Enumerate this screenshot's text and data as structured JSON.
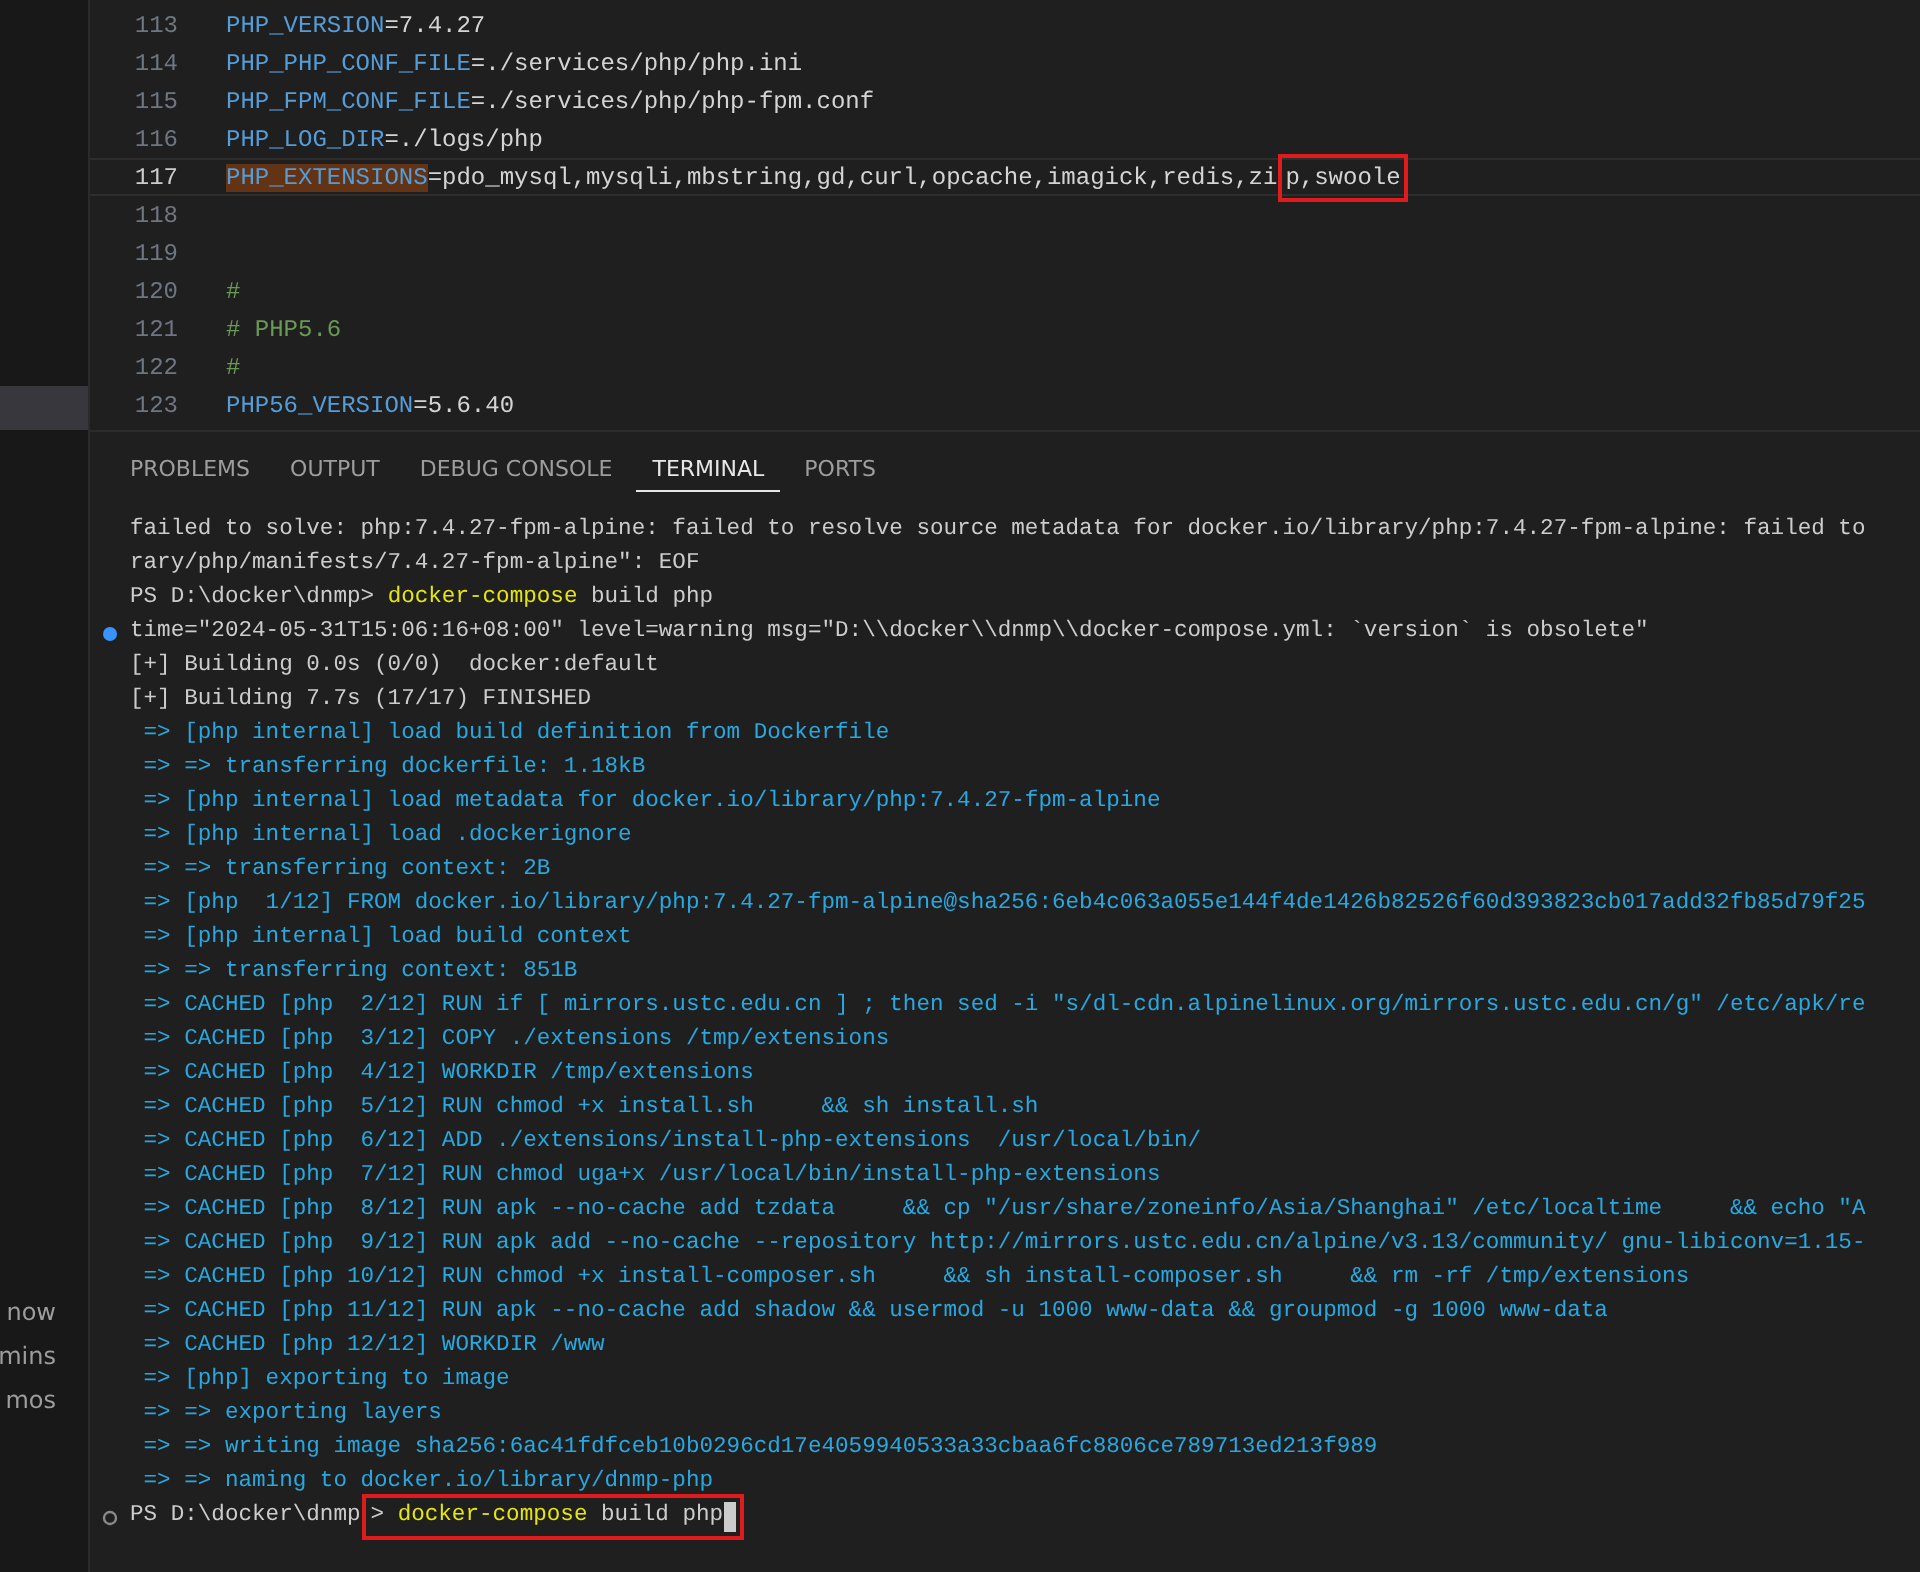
{
  "sidebar": {
    "times": [
      "now",
      "mins",
      "mos"
    ]
  },
  "editor": {
    "lines": [
      {
        "number": "113",
        "current": false,
        "segments": [
          {
            "text": "PHP_VERSION",
            "kind": "key"
          },
          {
            "text": "=7.4.27",
            "kind": "value"
          }
        ]
      },
      {
        "number": "114",
        "current": false,
        "segments": [
          {
            "text": "PHP_PHP_CONF_FILE",
            "kind": "key"
          },
          {
            "text": "=./services/php/php.ini",
            "kind": "value"
          }
        ]
      },
      {
        "number": "115",
        "current": false,
        "segments": [
          {
            "text": "PHP_FPM_CONF_FILE",
            "kind": "key"
          },
          {
            "text": "=./services/php/php-fpm.conf",
            "kind": "value"
          }
        ]
      },
      {
        "number": "116",
        "current": false,
        "segments": [
          {
            "text": "PHP_LOG_DIR",
            "kind": "key"
          },
          {
            "text": "=./logs/php",
            "kind": "value"
          }
        ]
      },
      {
        "number": "117",
        "current": true,
        "segments": [
          {
            "text": "PHP_EXTENSIONS",
            "kind": "key",
            "highlighted": true
          },
          {
            "text": "=pdo_mysql,mysqli,mbstring,gd,curl,opcache,imagick,redis,zi",
            "kind": "value"
          },
          {
            "text": "p,swoole",
            "kind": "value",
            "boxed": true
          }
        ]
      },
      {
        "number": "118",
        "current": false
      },
      {
        "number": "119",
        "current": false
      },
      {
        "number": "120",
        "current": false,
        "segments": [
          {
            "text": "#",
            "kind": "comment"
          }
        ]
      },
      {
        "number": "121",
        "current": false,
        "segments": [
          {
            "text": "# PHP5.6",
            "kind": "comment"
          }
        ]
      },
      {
        "number": "122",
        "current": false,
        "segments": [
          {
            "text": "#",
            "kind": "comment"
          }
        ]
      },
      {
        "number": "123",
        "current": false,
        "segments": [
          {
            "text": "PHP56_VERSION",
            "kind": "key"
          },
          {
            "text": "=5.6.40",
            "kind": "value"
          }
        ]
      }
    ]
  },
  "panel": {
    "tabs": [
      {
        "label": "PROBLEMS",
        "selected": false
      },
      {
        "label": "OUTPUT",
        "selected": false
      },
      {
        "label": "DEBUG CONSOLE",
        "selected": false
      },
      {
        "label": "TERMINAL",
        "selected": true
      },
      {
        "label": "PORTS",
        "selected": false
      }
    ]
  },
  "terminal": {
    "lines": [
      {
        "segments": [
          {
            "text": "failed to solve: php:7.4.27-fpm-alpine: failed to resolve source metadata for docker.io/library/php:7.4.27-fpm-alpine: failed to",
            "kind": "plain"
          }
        ]
      },
      {
        "segments": [
          {
            "text": "rary/php/manifests/7.4.27-fpm-alpine\": EOF",
            "kind": "plain"
          }
        ]
      },
      {
        "segments": [
          {
            "text": "PS D:\\docker\\dnmp> ",
            "kind": "plain"
          },
          {
            "text": "docker-compose",
            "kind": "command"
          },
          {
            "text": " build php",
            "kind": "plain"
          }
        ]
      },
      {
        "kind": "dot",
        "segments": [
          {
            "text": "time=\"2024-05-31T15:06:16+08:00\" level=warning msg=\"D:\\\\docker\\\\dnmp\\\\docker-compose.yml: `version` is obsolete\"",
            "kind": "plain"
          }
        ]
      },
      {
        "segments": [
          {
            "text": "[+] Building 0.0s (0/0)  docker:default",
            "kind": "plain"
          }
        ]
      },
      {
        "segments": [
          {
            "text": "[+] Building 7.7s (17/17) FINISHED",
            "kind": "plain"
          }
        ]
      },
      {
        "segments": [
          {
            "text": " => [php internal] load build definition from Dockerfile",
            "kind": "step"
          }
        ]
      },
      {
        "segments": [
          {
            "text": " => => transferring dockerfile: 1.18kB",
            "kind": "step"
          }
        ]
      },
      {
        "segments": [
          {
            "text": " => [php internal] load metadata for docker.io/library/php:7.4.27-fpm-alpine",
            "kind": "step"
          }
        ]
      },
      {
        "segments": [
          {
            "text": " => [php internal] load .dockerignore",
            "kind": "step"
          }
        ]
      },
      {
        "segments": [
          {
            "text": " => => transferring context: 2B",
            "kind": "step"
          }
        ]
      },
      {
        "segments": [
          {
            "text": " => [php  1/12] FROM docker.io/library/php:7.4.27-fpm-alpine@sha256:6eb4c063a055e144f4de1426b82526f60d393823cb017add32fb85d79f25",
            "kind": "step"
          }
        ]
      },
      {
        "segments": [
          {
            "text": " => [php internal] load build context",
            "kind": "step"
          }
        ]
      },
      {
        "segments": [
          {
            "text": " => => transferring context: 851B",
            "kind": "step"
          }
        ]
      },
      {
        "segments": [
          {
            "text": " => CACHED [php  2/12] RUN if [ mirrors.ustc.edu.cn ] ; then sed -i \"s/dl-cdn.alpinelinux.org/mirrors.ustc.edu.cn/g\" /etc/apk/re",
            "kind": "step"
          }
        ]
      },
      {
        "segments": [
          {
            "text": " => CACHED [php  3/12] COPY ./extensions /tmp/extensions",
            "kind": "step"
          }
        ]
      },
      {
        "segments": [
          {
            "text": " => CACHED [php  4/12] WORKDIR /tmp/extensions",
            "kind": "step"
          }
        ]
      },
      {
        "segments": [
          {
            "text": " => CACHED [php  5/12] RUN chmod +x install.sh     && sh install.sh",
            "kind": "step"
          }
        ]
      },
      {
        "segments": [
          {
            "text": " => CACHED [php  6/12] ADD ./extensions/install-php-extensions  /usr/local/bin/",
            "kind": "step"
          }
        ]
      },
      {
        "segments": [
          {
            "text": " => CACHED [php  7/12] RUN chmod uga+x /usr/local/bin/install-php-extensions",
            "kind": "step"
          }
        ]
      },
      {
        "segments": [
          {
            "text": " => CACHED [php  8/12] RUN apk --no-cache add tzdata     && cp \"/usr/share/zoneinfo/Asia/Shanghai\" /etc/localtime     && echo \"A",
            "kind": "step"
          }
        ]
      },
      {
        "segments": [
          {
            "text": " => CACHED [php  9/12] RUN apk add --no-cache --repository http://mirrors.ustc.edu.cn/alpine/v3.13/community/ gnu-libiconv=1.15-",
            "kind": "step"
          }
        ]
      },
      {
        "segments": [
          {
            "text": " => CACHED [php 10/12] RUN chmod +x install-composer.sh     && sh install-composer.sh     && rm -rf /tmp/extensions",
            "kind": "step"
          }
        ]
      },
      {
        "segments": [
          {
            "text": " => CACHED [php 11/12] RUN apk --no-cache add shadow && usermod -u 1000 www-data && groupmod -g 1000 www-data",
            "kind": "step"
          }
        ]
      },
      {
        "segments": [
          {
            "text": " => CACHED [php 12/12] WORKDIR /www",
            "kind": "step"
          }
        ]
      },
      {
        "segments": [
          {
            "text": " => [php] exporting to image",
            "kind": "step"
          }
        ]
      },
      {
        "segments": [
          {
            "text": " => => exporting layers",
            "kind": "step"
          }
        ]
      },
      {
        "segments": [
          {
            "text": " => => writing image sha256:6ac41fdfceb10b0296cd17e4059940533a33cbaa6fc8806ce789713ed213f989",
            "kind": "step"
          }
        ]
      },
      {
        "segments": [
          {
            "text": " => => naming to docker.io/library/dnmp-php",
            "kind": "step"
          }
        ]
      },
      {
        "kind": "circle",
        "cursor": true,
        "segments": [
          {
            "text": "PS D:\\docker\\dnmp",
            "kind": "plain"
          },
          {
            "text": "> ",
            "kind": "plain",
            "boxed": true
          },
          {
            "text": "docker-compose",
            "kind": "command",
            "boxed": true
          },
          {
            "text": " build php",
            "kind": "plain",
            "boxed": true
          }
        ]
      }
    ]
  }
}
